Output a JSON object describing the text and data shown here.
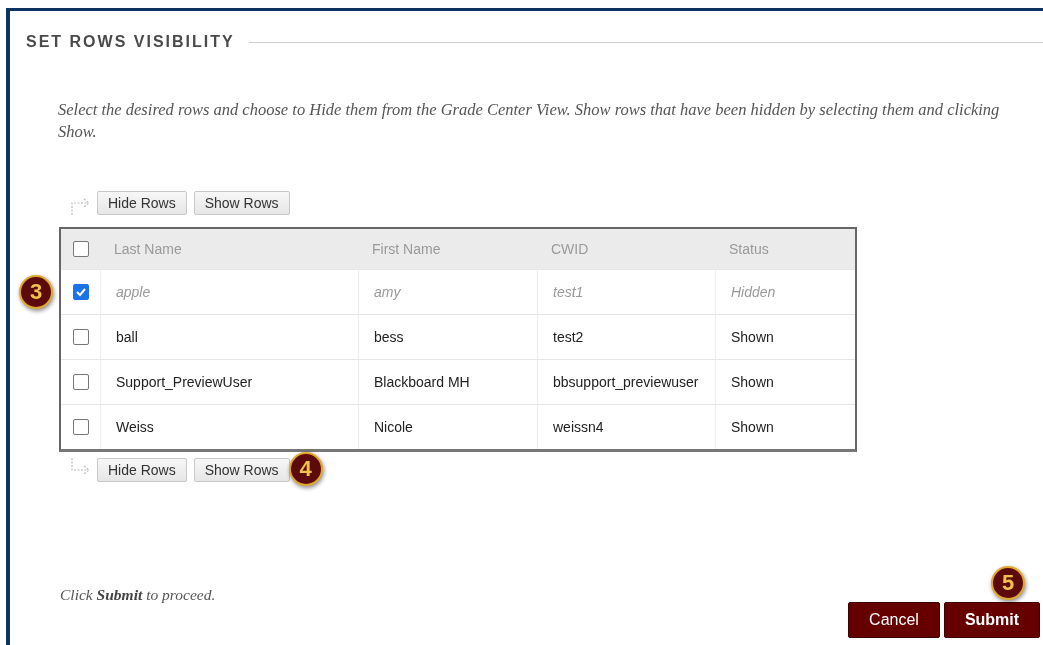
{
  "section": {
    "title": "SET ROWS VISIBILITY",
    "instructions": "Select the desired rows and choose to Hide them from the Grade Center View. Show rows that have been hidden by selecting them and clicking Show."
  },
  "top_toolbar": {
    "buttons": [
      {
        "label": "Hide Rows"
      },
      {
        "label": "Show Rows"
      }
    ]
  },
  "table": {
    "header_checkbox": {
      "checked": false
    },
    "columns": [
      "Last Name",
      "First Name",
      "CWID",
      "Status"
    ],
    "rows": [
      {
        "checked": true,
        "hidden": true,
        "callout": "3",
        "cells": [
          "apple",
          "amy",
          "test1",
          "Hidden"
        ]
      },
      {
        "checked": false,
        "hidden": false,
        "cells": [
          "ball",
          "bess",
          "test2",
          "Shown"
        ]
      },
      {
        "checked": false,
        "hidden": false,
        "cells": [
          "Support_PreviewUser",
          "Blackboard MH",
          "bbsupport_previewuser",
          "Shown"
        ]
      },
      {
        "checked": false,
        "hidden": false,
        "cells": [
          "Weiss",
          "Nicole",
          "weissn4",
          "Shown"
        ]
      }
    ]
  },
  "bottom_toolbar": {
    "buttons": [
      {
        "label": "Hide Rows"
      },
      {
        "label": "Show Rows",
        "callout": "4"
      }
    ]
  },
  "footer": {
    "note": "Click **Submit** to proceed.",
    "buttons": [
      {
        "label": "Cancel"
      },
      {
        "label": "Submit",
        "callout": "5"
      }
    ]
  }
}
